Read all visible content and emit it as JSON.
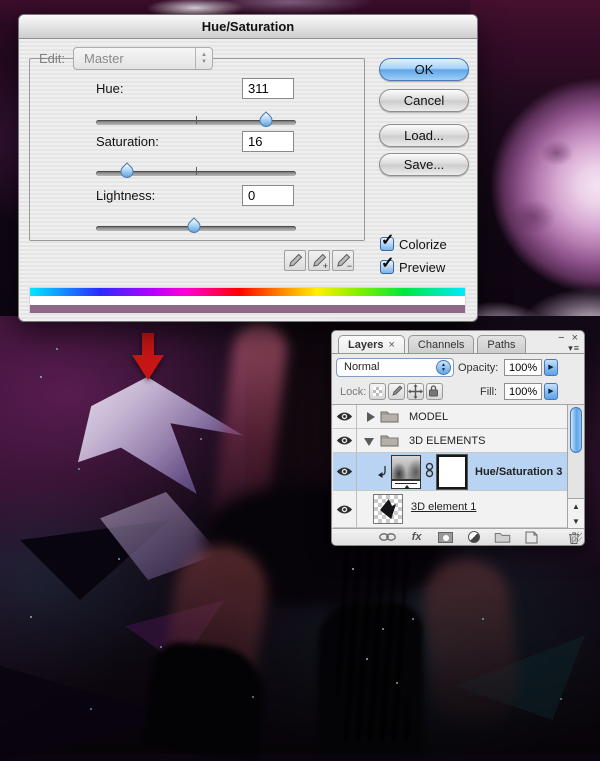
{
  "dialog": {
    "title": "Hue/Saturation",
    "edit": {
      "label": "Edit:",
      "value": "Master"
    },
    "sliders": [
      {
        "label": "Hue:",
        "value": "311",
        "pos_pct": 85
      },
      {
        "label": "Saturation:",
        "value": "16",
        "pos_pct": 15.5
      },
      {
        "label": "Lightness:",
        "value": "0",
        "pos_pct": 49
      }
    ],
    "buttons": {
      "ok": "OK",
      "cancel": "Cancel",
      "load": "Load...",
      "save": "Save..."
    },
    "eyedroppers": [
      {
        "name": "sample-eyedropper",
        "glyph": ""
      },
      {
        "name": "add-eyedropper",
        "glyph": "+"
      },
      {
        "name": "subtract-eyedropper",
        "glyph": "−"
      }
    ],
    "checkboxes": [
      {
        "label": "Colorize",
        "checked": true
      },
      {
        "label": "Preview",
        "checked": true
      }
    ],
    "result_bar_color": "#8e6886"
  },
  "layers_panel": {
    "window": {
      "minimize_glyph": "−",
      "close_glyph": "×"
    },
    "tabs": [
      {
        "label": "Layers",
        "close_glyph": "×",
        "active": true
      },
      {
        "label": "Channels",
        "active": false
      },
      {
        "label": "Paths",
        "active": false
      }
    ],
    "blend_mode": "Normal",
    "opacity": {
      "label": "Opacity:",
      "value": "100%"
    },
    "lock_label": "Lock:",
    "fill": {
      "label": "Fill:",
      "value": "100%"
    },
    "layers": [
      {
        "name": "MODEL",
        "kind": "group",
        "expanded": false
      },
      {
        "name": "3D ELEMENTS",
        "kind": "group",
        "expanded": true
      },
      {
        "name": "Hue/Saturation 3",
        "kind": "adjustment",
        "selected": true,
        "clipped": true
      },
      {
        "name": "3D element 1",
        "kind": "raster"
      }
    ],
    "footer_fx_glyph": "fx",
    "colors": {
      "selected_row": "#b9d3f3",
      "aqua_accent": "#5aa0e8"
    }
  },
  "icons": {
    "up": "▲",
    "down": "▼",
    "right": "▶",
    "check": "✓",
    "menu": "▾≡"
  },
  "scene": {
    "arrow_color": "#c81616"
  }
}
